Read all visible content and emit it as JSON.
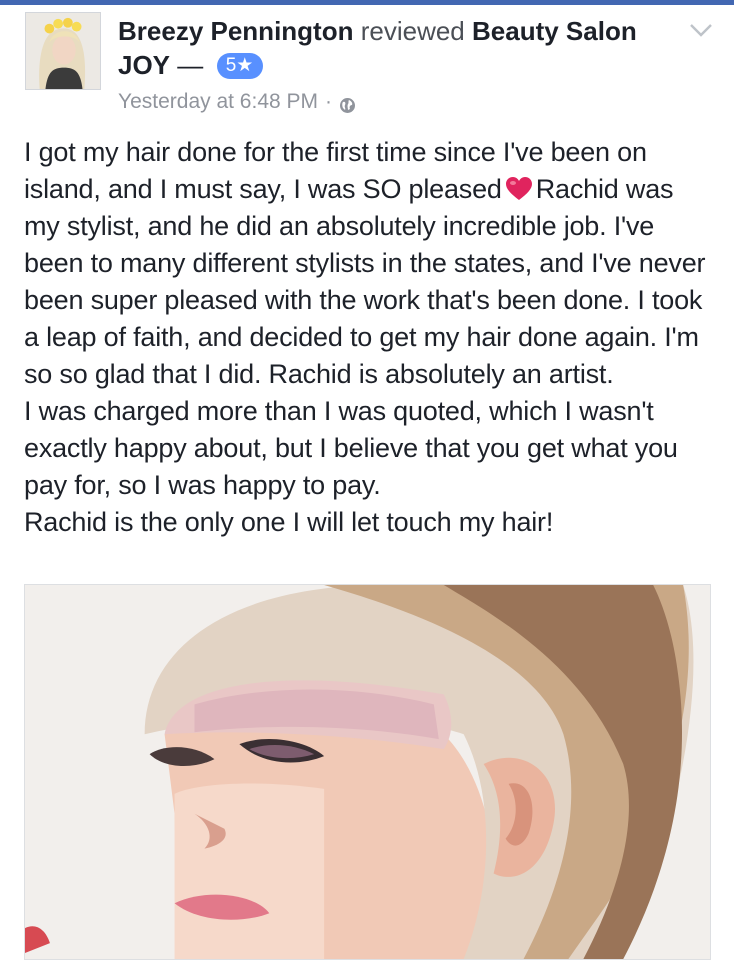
{
  "colors": {
    "top_bar": "#4267b2",
    "text_primary": "#1d2129",
    "text_secondary": "#90949c",
    "rating_badge": "#5890ff",
    "heart": "#e0245e"
  },
  "post": {
    "author_name": "Breezy Pennington",
    "action_text": "reviewed",
    "page_name": "Beauty Salon JOY",
    "separator": "—",
    "rating_label": "5★",
    "timestamp": "Yesterday at 6:48 PM",
    "privacy_icon": "globe-icon",
    "menu_icon": "chevron-down-icon"
  },
  "review": {
    "part1": "I got my hair done for the first time since I've been on island, and I must say, I was SO pleased",
    "heart_icon": "heart-emoji",
    "part2": "Rachid was my stylist, and he did an absolutely incredible job. I've been to many different stylists in the states, and I've never been super pleased with the work that's been done. I took a leap of faith, and decided to get my hair done again. I'm so so glad that I did. Rachid is absolutely an artist.",
    "paragraph2": "I was charged more than I was quoted, which I wasn't exactly happy about, but I believe that you get what you pay for, so I was happy to pay.",
    "paragraph3": "Rachid is the only one I will let touch my hair!"
  },
  "attachment": {
    "image": "photo of a short platinum pixie haircut with pink-tinted fringe"
  }
}
